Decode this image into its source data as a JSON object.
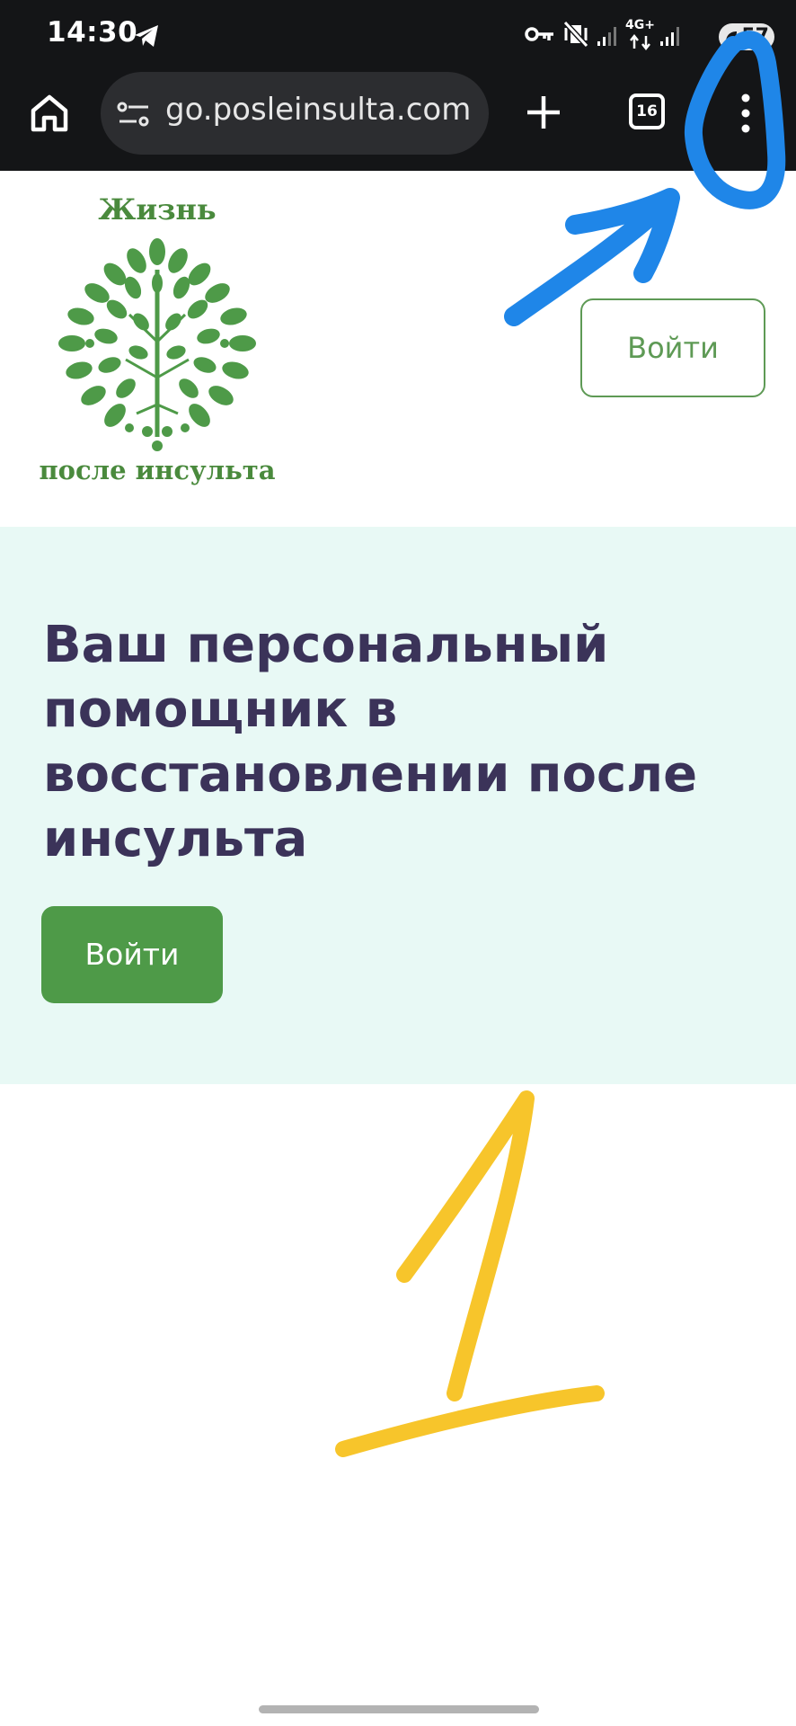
{
  "status_bar": {
    "time": "14:30",
    "network_label": "4G+",
    "battery": "57",
    "icons": [
      "telegram-icon",
      "key-icon",
      "vibrate-mute-icon",
      "signal-icon",
      "data-arrows-icon",
      "signal-icon",
      "battery-saver-leaf-icon"
    ]
  },
  "browser": {
    "url": "go.posleinsulta.com",
    "tab_count": "16",
    "icons": [
      "home-icon",
      "site-settings-icon",
      "new-tab-plus-icon",
      "tab-switcher-icon",
      "overflow-menu-icon"
    ]
  },
  "header": {
    "logo_top_text": "Жизнь",
    "logo_bottom_text": "после инсульта",
    "login_label": "Войти"
  },
  "hero": {
    "title": "Ваш персональный помощник в восстановлении после инсульта",
    "login_label": "Войти",
    "background": "#e8f9f5",
    "title_color": "#3b3359",
    "button_color": "#4e9a48"
  },
  "annotations": {
    "step_number": "1",
    "marker_blue": "#1f86e8",
    "marker_yellow": "#f7c52b"
  }
}
